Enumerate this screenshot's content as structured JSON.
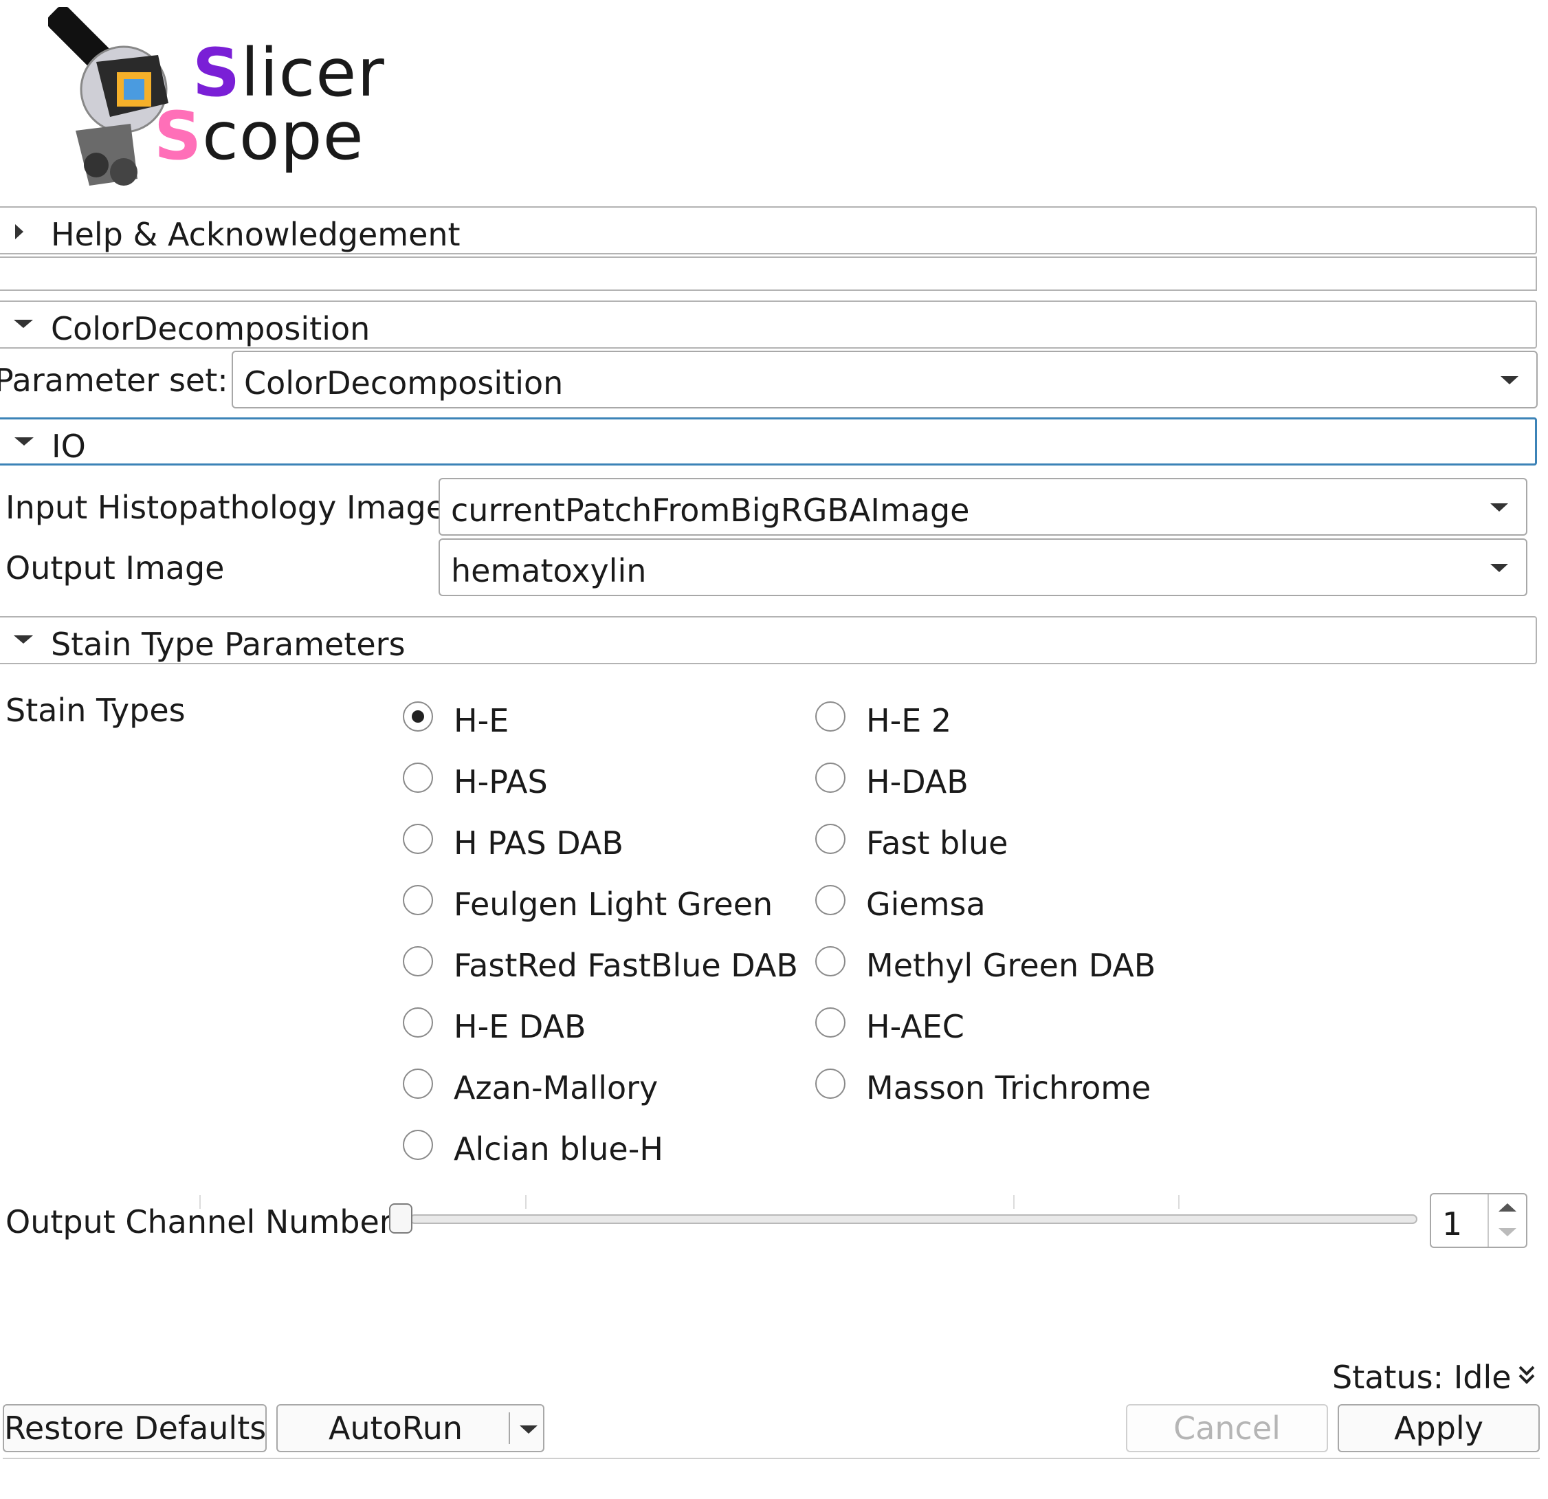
{
  "logo": {
    "line1": "Slicer",
    "line2": "Scope",
    "line1_accent": "#7a1fd6",
    "line2_accent": "#ff6fb8"
  },
  "sections": {
    "help": "Help & Acknowledgement",
    "color_decomposition": "ColorDecomposition",
    "io": "IO",
    "stain_type_parameters": "Stain Type Parameters"
  },
  "parameter_set": {
    "label": "Parameter set:",
    "value": "ColorDecomposition"
  },
  "io": {
    "input_label": "Input Histopathology Image",
    "input_value": "currentPatchFromBigRGBAImage",
    "output_label": "Output Image",
    "output_value": "hematoxylin"
  },
  "stain": {
    "label": "Stain Types",
    "selected": "H-E",
    "options": [
      "H-E",
      "H-E 2",
      "H-PAS",
      "H-DAB",
      "H PAS DAB",
      "Fast blue",
      "Feulgen Light Green",
      "Giemsa",
      "FastRed FastBlue DAB",
      "Methyl Green DAB",
      "H-E DAB",
      "H-AEC",
      "Azan-Mallory",
      "Masson Trichrome",
      "Alcian blue-H"
    ]
  },
  "output_channel": {
    "label": "Output Channel Number",
    "value": "1"
  },
  "status": {
    "text": "Status: Idle"
  },
  "buttons": {
    "restore_defaults": "Restore Defaults",
    "autorun": "AutoRun",
    "cancel": "Cancel",
    "apply": "Apply"
  },
  "icons": {
    "logo": "slicerscope-microscope-logo",
    "expand_collapsed": "triangle-right-icon",
    "expand_open": "triangle-down-icon",
    "combo": "chevron-down-icon",
    "status": "double-chevron-down-icon"
  },
  "colors": {
    "focus_border": "#3c83b7"
  }
}
